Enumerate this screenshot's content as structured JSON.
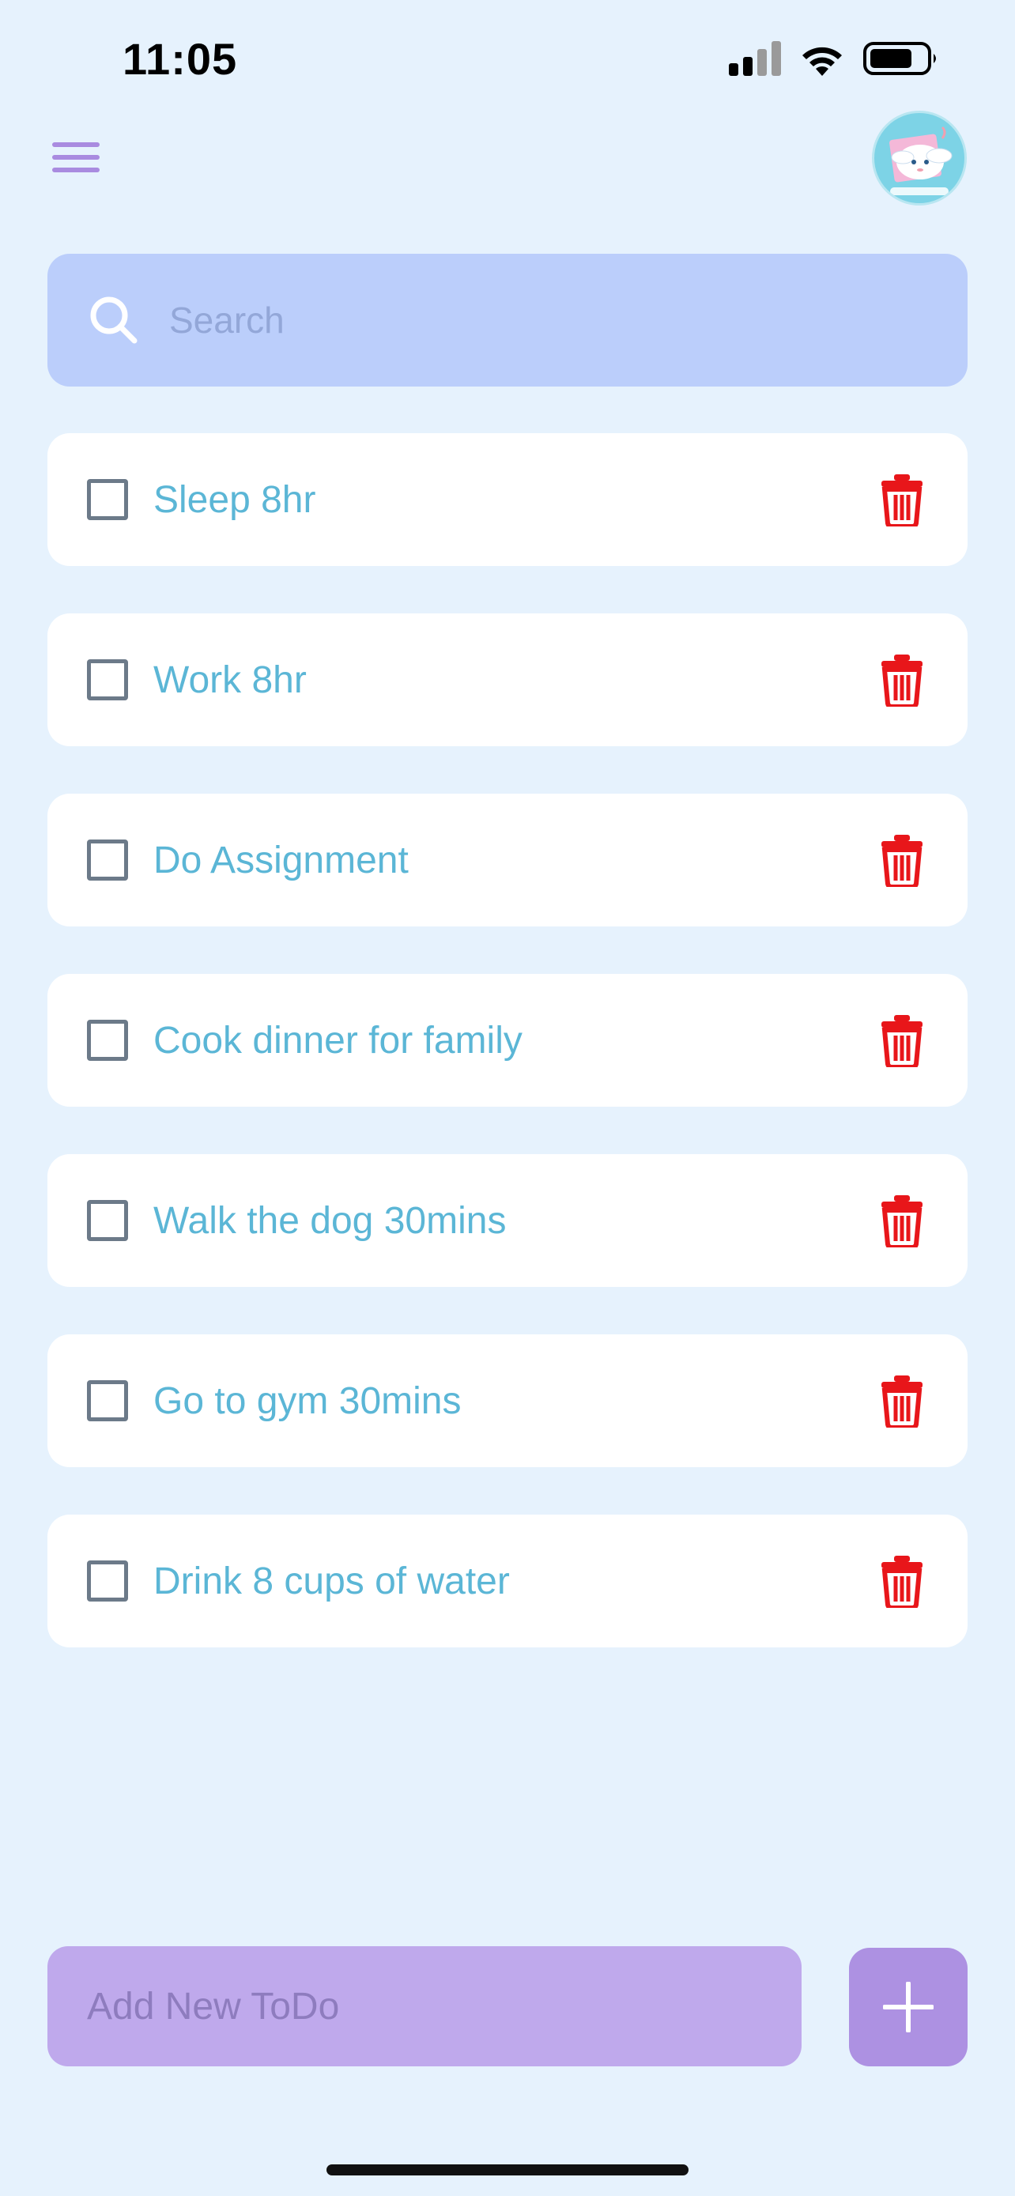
{
  "status_bar": {
    "time": "11:05",
    "icons": [
      "cellular-signal-icon",
      "wifi-icon",
      "battery-icon"
    ]
  },
  "header": {
    "menu_icon": "hamburger-menu-icon",
    "avatar_icon": "character-avatar-icon"
  },
  "search": {
    "placeholder": "Search",
    "value": "",
    "icon": "search-icon"
  },
  "todos": [
    {
      "text": "Sleep 8hr",
      "checked": false
    },
    {
      "text": "Work 8hr",
      "checked": false
    },
    {
      "text": "Do Assignment",
      "checked": false
    },
    {
      "text": "Cook dinner for family",
      "checked": false
    },
    {
      "text": "Walk the dog 30mins",
      "checked": false
    },
    {
      "text": "Go to gym 30mins",
      "checked": false
    },
    {
      "text": "Drink 8 cups of water",
      "checked": false
    }
  ],
  "add_todo": {
    "placeholder": "Add New ToDo",
    "value": "",
    "button_icon": "plus-icon"
  },
  "colors": {
    "background": "#E6F2FD",
    "search_bg": "#BBCEFB",
    "item_text": "#5BB6D6",
    "delete": "#E8161A",
    "add_input_bg": "#BFA9EC",
    "add_button_bg": "#AD91E2",
    "menu": "#A98BE0"
  }
}
